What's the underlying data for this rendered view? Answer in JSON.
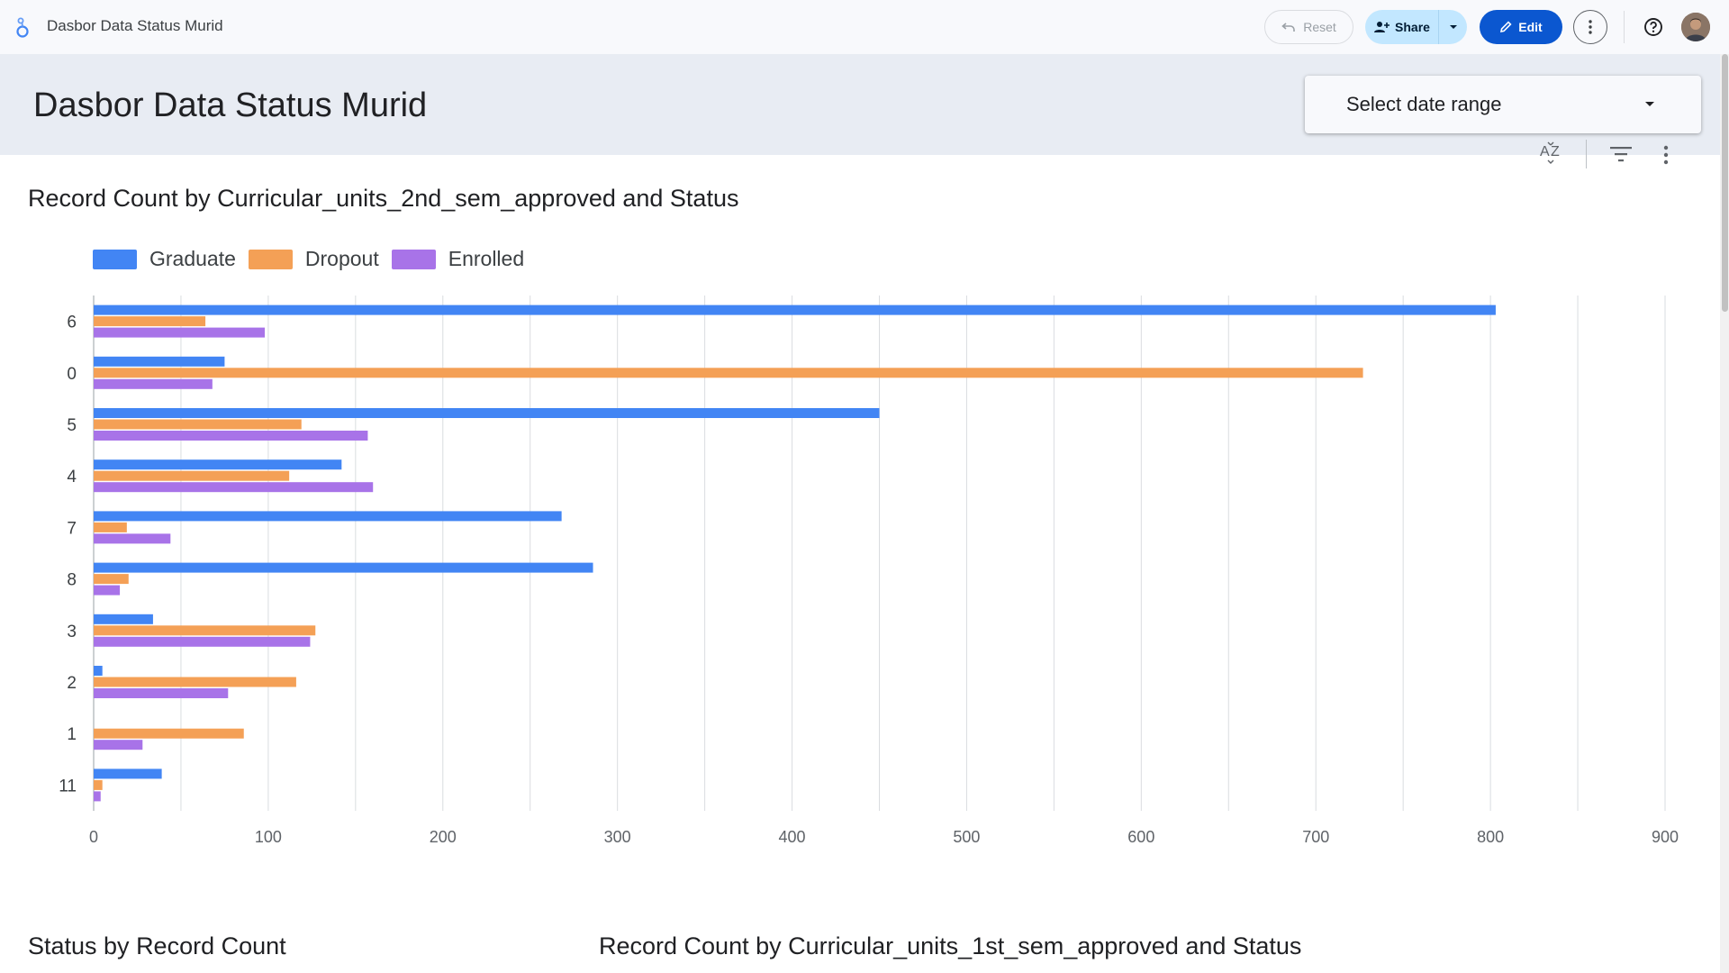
{
  "app": {
    "title": "Dasbor Data Status Murid",
    "reset_label": "Reset",
    "share_label": "Share",
    "edit_label": "Edit"
  },
  "report": {
    "title": "Dasbor Data Status Murid",
    "date_range_label": "Select date range"
  },
  "colors": {
    "Graduate": "#4285f4",
    "Dropout": "#f4a056",
    "Enrolled": "#a873e8",
    "accent": "#0b57d0"
  },
  "chart_data": {
    "type": "bar",
    "orientation": "horizontal",
    "title": "Record Count by Curricular_units_2nd_sem_approved and Status",
    "legend": [
      "Graduate",
      "Dropout",
      "Enrolled"
    ],
    "legend_position": "top-left",
    "categories": [
      "6",
      "0",
      "5",
      "4",
      "7",
      "8",
      "3",
      "2",
      "1",
      "11"
    ],
    "series": [
      {
        "name": "Graduate",
        "values": [
          803,
          75,
          450,
          142,
          268,
          286,
          34,
          5,
          0,
          39
        ]
      },
      {
        "name": "Dropout",
        "values": [
          64,
          727,
          119,
          112,
          19,
          20,
          127,
          116,
          86,
          5
        ]
      },
      {
        "name": "Enrolled",
        "values": [
          98,
          68,
          157,
          160,
          44,
          15,
          124,
          77,
          28,
          4
        ]
      }
    ],
    "xlim": [
      0,
      900
    ],
    "xticks": [
      0,
      100,
      200,
      300,
      400,
      500,
      600,
      700,
      800,
      900
    ],
    "grid": true
  },
  "sections": {
    "left_title": "Status by Record Count",
    "right_title": "Record Count by Curricular_units_1st_sem_approved and Status"
  },
  "icons": {
    "app_logo": "looker-studio-logo-icon",
    "reset": "undo-icon",
    "share": "person-add-icon",
    "edit": "pencil-icon",
    "more": "more-vert-icon",
    "help": "help-circle-icon",
    "sort": "sort-az-icon",
    "filter": "filter-icon",
    "chart_menu": "more-vert-icon"
  }
}
